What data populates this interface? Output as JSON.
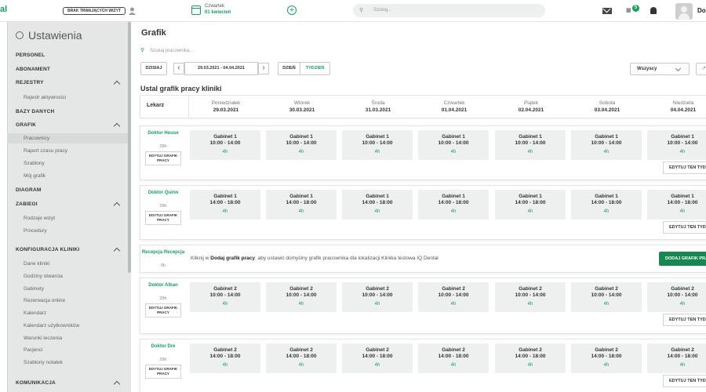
{
  "topbar": {
    "logo": "al",
    "no_visits_label": "BRAK TRWAJĄCYCH WIZYT",
    "date_day": "Czwartek",
    "date_date": "01 kwiecień",
    "search_placeholder": "Szukaj...",
    "notification_count": "5",
    "user_name": "Do"
  },
  "sidebar": {
    "title": "Ustawienia",
    "sections": [
      {
        "label": "PERSONEL"
      },
      {
        "label": "ABONAMENT"
      },
      {
        "label": "REJESTRY",
        "items": [
          "Rejestr aktywności"
        ]
      },
      {
        "label": "BAZY DANYCH"
      },
      {
        "label": "GRAFIK",
        "items": [
          "Pracownicy",
          "Raport czasu pracy",
          "Szablony",
          "Mój grafik"
        ]
      },
      {
        "label": "DIAGRAM"
      },
      {
        "label": "ZABIEGI",
        "items": [
          "Rodzaje wizyt",
          "Procedury"
        ]
      },
      {
        "label": "KONFIGURACJA KLINIKI",
        "items": [
          "Dane kliniki",
          "Godziny otwarcia",
          "Gabinety",
          "Rezerwacja online",
          "Kalendarz",
          "Kalendarz użytkowników",
          "Warunki leczenia",
          "Pacjenci",
          "Szablony notatek"
        ]
      },
      {
        "label": "KOMUNIKACJA"
      }
    ]
  },
  "main": {
    "title": "Grafik",
    "employee_search_placeholder": "Szukaj pracownika...",
    "today_label": "DZISIAJ",
    "date_range": "29.03.2021 - 04.04.2021",
    "view_day": "DZIEŃ",
    "view_week": "TYDZIEŃ",
    "filter_value": "Wszyscy",
    "set_schedule_title": "Ustal grafik pracy kliniki",
    "column_lekarz": "Lekarz",
    "days": [
      {
        "name": "Poniedziałek",
        "date": "29.03.2021"
      },
      {
        "name": "Wtorek",
        "date": "30.03.2021"
      },
      {
        "name": "Środa",
        "date": "31.03.2021"
      },
      {
        "name": "Czwartek",
        "date": "01.04.2021"
      },
      {
        "name": "Piątek",
        "date": "02.04.2021"
      },
      {
        "name": "Sobota",
        "date": "03.04.2021"
      },
      {
        "name": "Niedziela",
        "date": "04.04.2021"
      }
    ],
    "edit_grafik_label": "EDYTUJ GRAFIK PRACY",
    "edit_type_label": "EDYTUJ TEN TYDZIEŃ",
    "add_grafik_label": "DODAJ GRAFIK PRACY",
    "rows": [
      {
        "doctor": "Doktor House",
        "hours": "28h",
        "room": "Gabinet 1",
        "time": "10:00 - 14:00",
        "duration": "4h"
      },
      {
        "doctor": "Doktor Quinn",
        "hours": "28h",
        "room": "Gabinet 1",
        "time": "14:00 - 18:00",
        "duration": "4h"
      },
      {
        "doctor": "Recepcja Recepcja",
        "hours": "0h"
      },
      {
        "doctor": "Doktor Alban",
        "hours": "28h",
        "room": "Gabinet 2",
        "time": "10:00 - 14:00",
        "duration": "4h"
      },
      {
        "doctor": "Doktor Dre",
        "hours": "28h",
        "room": "Gabinet 2",
        "time": "14:00 - 18:00",
        "duration": "4h"
      }
    ],
    "reception_message_pre": "Kliknij w ",
    "reception_message_bold": "Dodaj grafik pracy",
    "reception_message_post": ", aby ustawić domyślny grafik pracownika dla lokalizacji Klinika testowa IQ Dental"
  }
}
